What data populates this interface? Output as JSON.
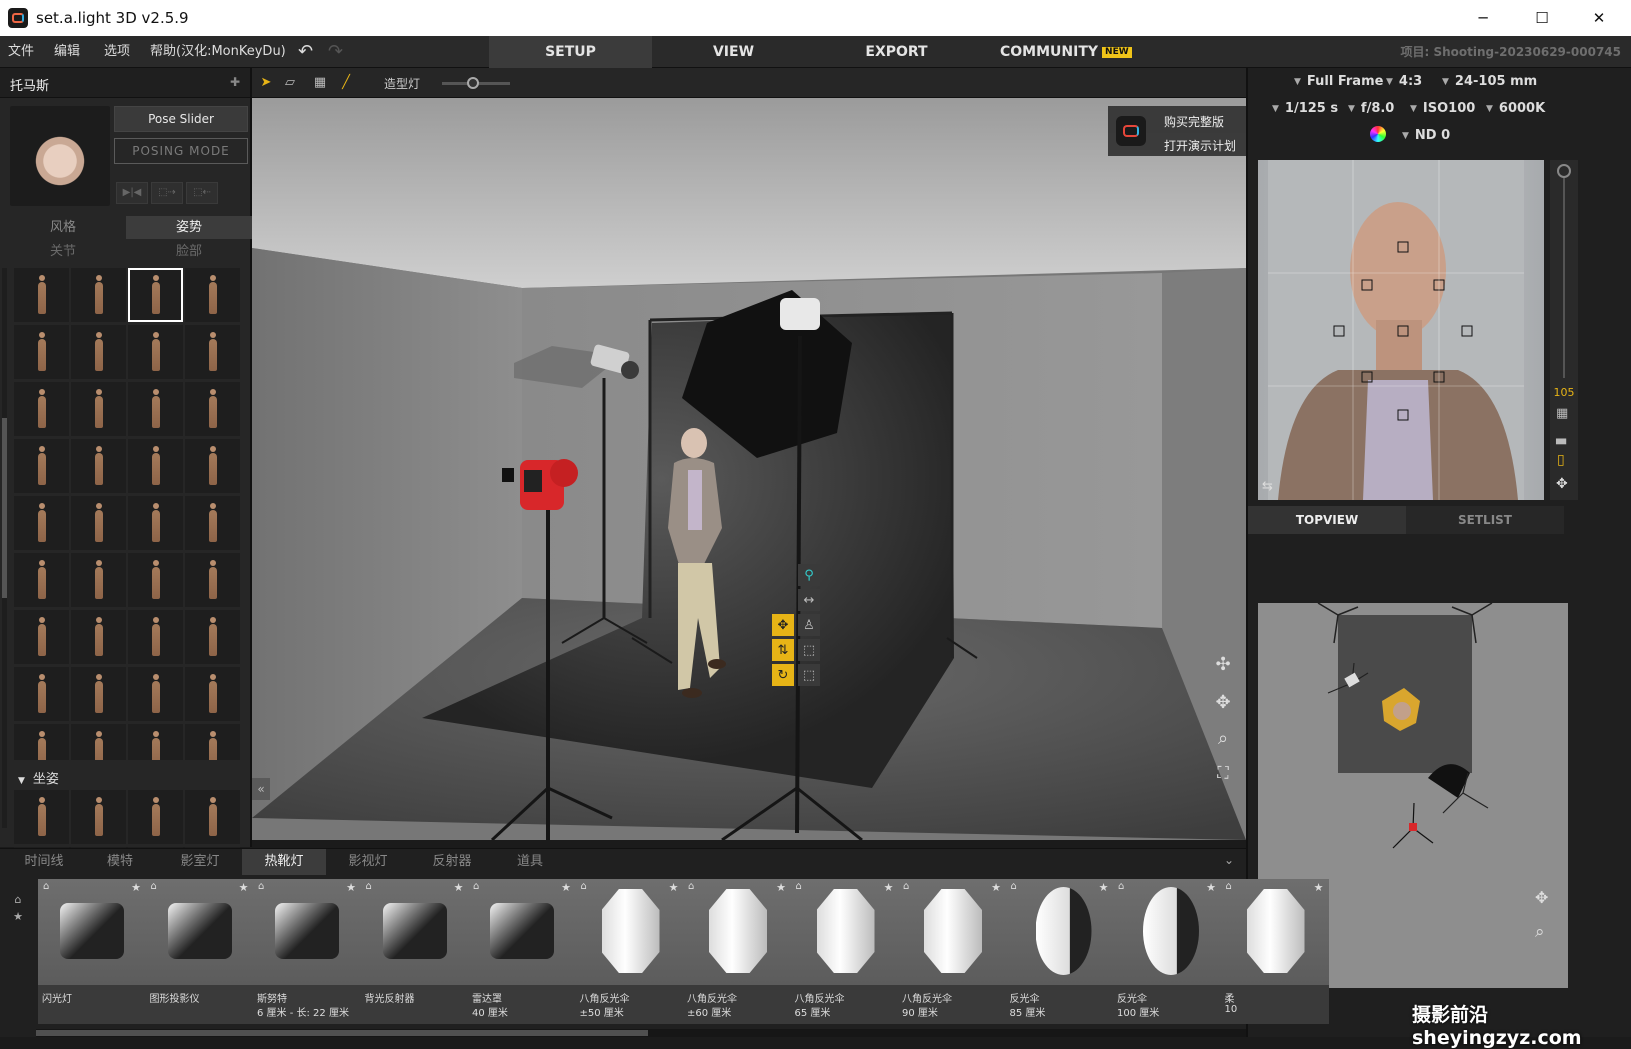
{
  "window": {
    "title": "set.a.light 3D v2.5.9",
    "minimize": "─",
    "maximize": "☐",
    "close": "✕"
  },
  "menubar": {
    "items": [
      "文件",
      "编辑",
      "选项",
      "帮助(汉化:MonKeyDu)"
    ],
    "undo": "↶",
    "redo": "↷",
    "modes": [
      "SETUP",
      "VIEW",
      "EXPORT",
      "COMMUNITY"
    ],
    "new_badge": "NEW",
    "project": "项目: Shooting-20230629-000745"
  },
  "model_panel": {
    "name": "托马斯",
    "pin": "📌",
    "pose_slider": "Pose Slider",
    "posing_mode": "POSING MODE",
    "small_buttons": [
      "▶|◀",
      "⬚⇢",
      "⬚⇠"
    ],
    "tabs": {
      "style": "风格",
      "pose": "姿势",
      "joint": "关节",
      "face": "脸部"
    },
    "section_sitting": "坐姿",
    "collapse": "«"
  },
  "viewport_toolbar": {
    "modeling_light": "造型灯",
    "modeling_level": 0.45
  },
  "buy_box": {
    "buy": "购买完整版",
    "demo": "打开演示计划",
    "chevron": "›"
  },
  "gizmo_icons": [
    "walk-icon",
    "move-horizontal-icon",
    "move-icon",
    "pose-icon",
    "height-icon",
    "rotate-icon"
  ],
  "camera": {
    "sensor": "Full Frame",
    "aspect": "4:3",
    "lens": "24-105 mm",
    "shutter": "1/125 s",
    "aperture": "f/8.0",
    "iso": "ISO100",
    "wb": "6000K",
    "nd": "ND 0",
    "zoom": "105"
  },
  "right_tabs": {
    "topview": "TOPVIEW",
    "setlist": "SETLIST"
  },
  "bottom": {
    "tabs": [
      "时间线",
      "模特",
      "影室灯",
      "热靴灯",
      "影视灯",
      "反射器",
      "道具"
    ],
    "active_tab": "热靴灯",
    "cards": [
      {
        "name": "闪光灯",
        "size": ""
      },
      {
        "name": "图形投影仪",
        "size": ""
      },
      {
        "name": "斯努特",
        "size": "6 厘米 - 长:  22 厘米"
      },
      {
        "name": "背光反射器",
        "size": ""
      },
      {
        "name": "雷达罩",
        "size": "40 厘米"
      },
      {
        "name": "八角反光伞",
        "size": "±50 厘米"
      },
      {
        "name": "八角反光伞",
        "size": "±60 厘米"
      },
      {
        "name": "八角反光伞",
        "size": "65 厘米"
      },
      {
        "name": "八角反光伞",
        "size": "90 厘米"
      },
      {
        "name": "反光伞",
        "size": "85 厘米"
      },
      {
        "name": "反光伞",
        "size": "100 厘米"
      },
      {
        "name": "柔",
        "size": "10"
      }
    ]
  },
  "watermark": "摄影前沿sheyingzyz.com",
  "colors": {
    "accent": "#e7b416",
    "active_tab": "#3b3b3b",
    "panel": "#262626"
  }
}
